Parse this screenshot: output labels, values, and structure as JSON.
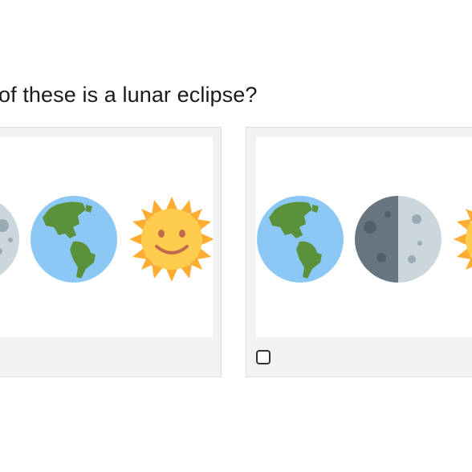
{
  "question": {
    "text": "of these is a lunar eclipse?"
  },
  "options": [
    {
      "icons": [
        "moon-icon",
        "earth-icon",
        "sun-icon"
      ],
      "checked": false
    },
    {
      "icons": [
        "earth-icon",
        "half-moon-icon",
        "sun-icon"
      ],
      "checked": false
    }
  ],
  "colors": {
    "ocean": "#8cc8f5",
    "land": "#5c913b",
    "moon_light": "#ccd6dd",
    "moon_dark": "#66757f",
    "sun": "#ffcc4d",
    "sun_rays": "#ffac33"
  }
}
